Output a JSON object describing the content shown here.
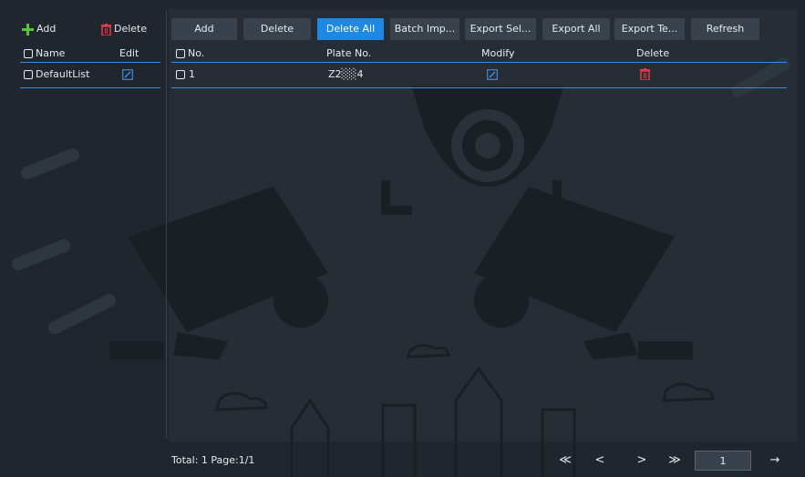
{
  "left_panel": {
    "add_label": "Add",
    "delete_label": "Delete",
    "col_name": "Name",
    "col_edit": "Edit",
    "rows": [
      {
        "name": "DefaultList"
      }
    ]
  },
  "toolbar": {
    "buttons": [
      "Add",
      "Delete",
      "Delete All",
      "Batch Imp...",
      "Export Sel...",
      "Export All",
      "Export Te...",
      "Refresh"
    ],
    "active_index": 2
  },
  "table": {
    "col_no": "No.",
    "col_plate": "Plate No.",
    "col_modify": "Modify",
    "col_delete": "Delete",
    "rows": [
      {
        "no": "1",
        "plate": "Z2░░4"
      }
    ]
  },
  "footer": {
    "total_text": "Total: 1  Page:1/1",
    "first": "≪",
    "prev": "<",
    "next": ">",
    "last": "≫",
    "page_input": "1",
    "go": "→"
  },
  "colors": {
    "accent": "#3f8be0",
    "active_button": "#1e88e5",
    "add_icon": "#57c534",
    "delete_icon": "#e53945"
  }
}
